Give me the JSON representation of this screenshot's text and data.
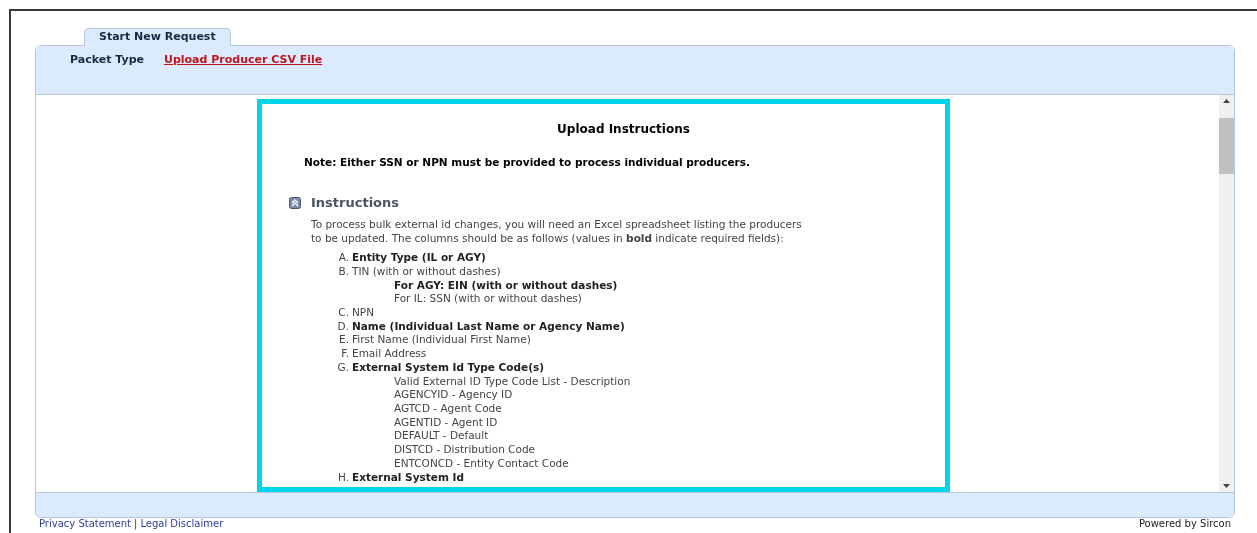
{
  "tabs": [
    {
      "label": "Start New Request",
      "selected": true
    }
  ],
  "header": {
    "label": "Packet Type",
    "link": "Upload Producer CSV File"
  },
  "content": {
    "title": "Upload Instructions",
    "note": "Note: Either SSN or NPN must be provided to process individual producers.",
    "section": {
      "title": "Instructions",
      "expanded": true
    },
    "intro": "To process bulk external id changes, you will need an Excel spreadsheet listing the producers to be updated. The columns should be as follows (values in **bold** indicate required fields):",
    "items": [
      {
        "marker": "A.",
        "text": "Entity Type (IL or AGY)",
        "bold": true
      },
      {
        "marker": "B.",
        "text": "TIN (with or without dashes)",
        "bold": false,
        "children": [
          {
            "text": "For AGY: EIN (with or without dashes)",
            "bold": true
          },
          {
            "text": "For IL: SSN (with or without dashes)",
            "bold": false
          }
        ]
      },
      {
        "marker": "C.",
        "text": "NPN",
        "bold": false
      },
      {
        "marker": "D.",
        "text": "Name (Individual Last Name or Agency Name)",
        "bold": true
      },
      {
        "marker": "E.",
        "text": "First Name (Individual First Name)",
        "bold": false
      },
      {
        "marker": "F.",
        "text": "Email Address",
        "bold": false
      },
      {
        "marker": "G.",
        "text": "External System Id Type Code(s)",
        "bold": true,
        "children": [
          {
            "text": "Valid External ID Type Code List - Description",
            "bold": false
          },
          {
            "text": "AGENCYID - Agency ID",
            "bold": false
          },
          {
            "text": "AGTCD - Agent Code",
            "bold": false
          },
          {
            "text": "AGENTID - Agent ID",
            "bold": false
          },
          {
            "text": "DEFAULT - Default",
            "bold": false
          },
          {
            "text": "DISTCD - Distribution Code",
            "bold": false
          },
          {
            "text": "ENTCONCD - Entity Contact Code",
            "bold": false
          }
        ]
      },
      {
        "marker": "H.",
        "text": "External System Id",
        "bold": true
      }
    ]
  },
  "footer": {
    "links": [
      "Privacy Statement",
      "Legal Disclaimer"
    ],
    "separator": "|",
    "powered_by": "Powered by Sircon"
  }
}
